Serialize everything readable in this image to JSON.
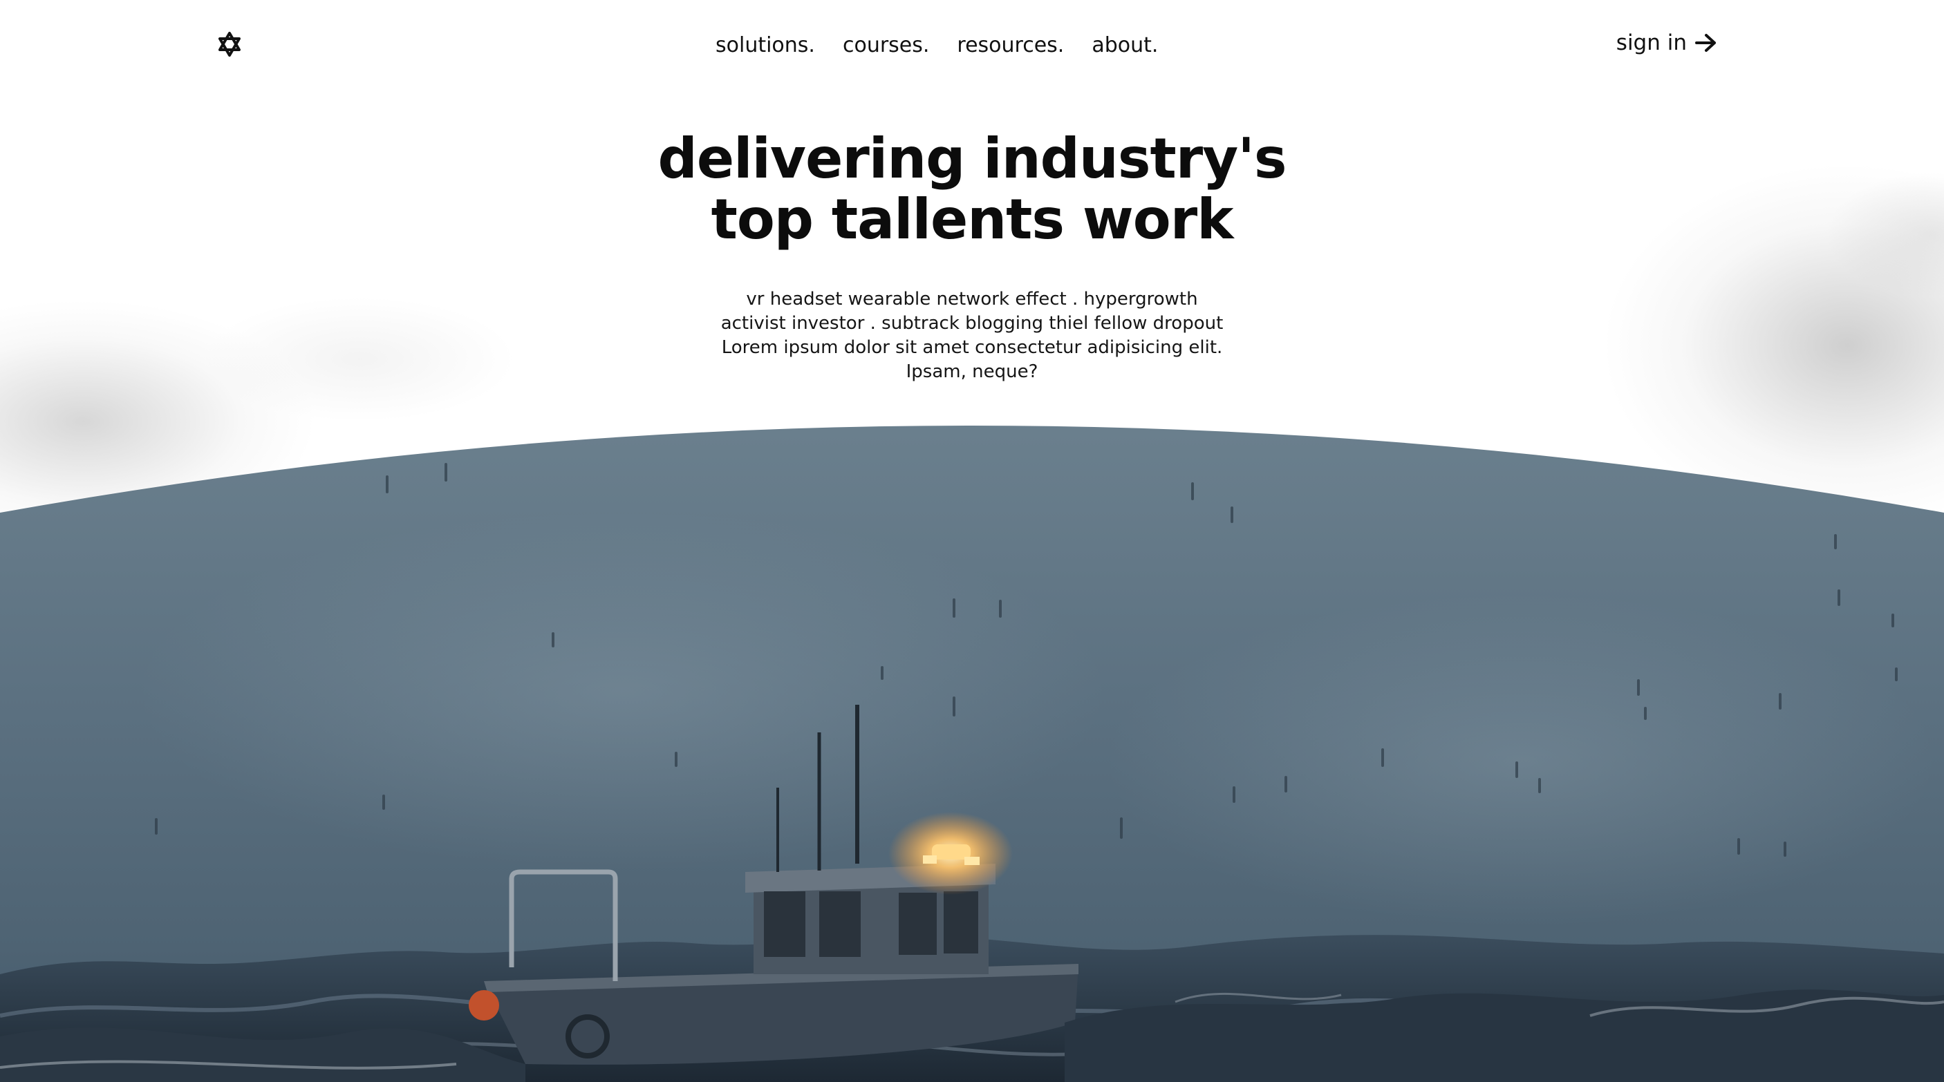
{
  "nav": {
    "logo_icon": "star-of-david-icon",
    "links": [
      "solutions.",
      "courses.",
      "resources.",
      "about."
    ],
    "sign_in_label": "sign in",
    "sign_in_icon": "arrow-right-icon"
  },
  "hero": {
    "title_line1": "delivering industry's",
    "title_line2": "top tallents work",
    "subtitle_lines": [
      "vr headset wearable network effect . hypergrowth",
      "activist investor . subtrack blogging thiel fellow dropout",
      "Lorem ipsum dolor sit amet consectetur adipisicing elit.",
      "Ipsam, neque?"
    ]
  },
  "scene": {
    "image_subject": "fishing-boat-in-stormy-sea",
    "colors": {
      "sky_top": "#6a7f8d",
      "sky_mid": "#54697a",
      "sea": "#2c3a48",
      "lamp": "#ffc46a"
    }
  }
}
